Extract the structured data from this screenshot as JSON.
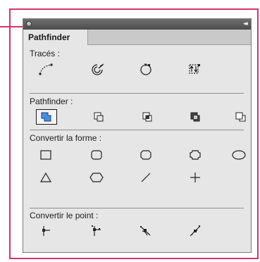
{
  "panel": {
    "tab_label": "Pathfinder",
    "collapse_glyph": "◂◂"
  },
  "sections": {
    "traces": {
      "label": "Tracés :",
      "tools": [
        "join-icon",
        "outline-stroke-icon",
        "close-path-icon",
        "reverse-path-icon"
      ]
    },
    "pathfinder": {
      "label": "Pathfinder :",
      "tools": [
        "add-icon",
        "subtract-icon",
        "intersect-icon",
        "exclude-icon",
        "minus-back-icon"
      ],
      "selected_index": 0
    },
    "convert_shape": {
      "label": "Convertir la forme :",
      "tools_row1": [
        "rectangle-icon",
        "rounded-rectangle-icon",
        "beveled-rectangle-icon",
        "inverse-rounded-rectangle-icon",
        "ellipse-icon"
      ],
      "tools_row2": [
        "triangle-icon",
        "polygon-icon",
        "line-icon",
        "orthogonal-line-icon"
      ]
    },
    "convert_point": {
      "label": "Convertir le point :",
      "tools": [
        "plain-point-icon",
        "corner-point-icon",
        "smooth-point-icon",
        "symmetrical-point-icon"
      ]
    }
  },
  "colors": {
    "callout_border": "#d8326b",
    "selected_fill": "#4a90d9"
  }
}
